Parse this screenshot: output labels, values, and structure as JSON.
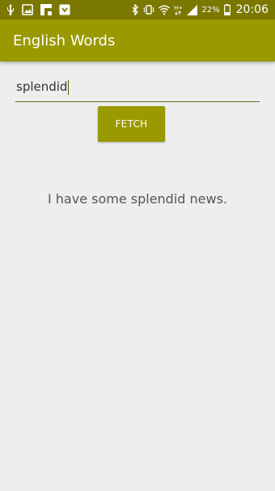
{
  "status_bar": {
    "icons": [
      "usb-icon",
      "image-icon",
      "flipboard-icon",
      "shield-icon",
      "bluetooth-icon",
      "vibrate-icon",
      "wifi-icon",
      "hplus-signal-icon",
      "signal-icon",
      "battery-icon"
    ],
    "battery_percent": "22%",
    "time": "20:06",
    "background": "#7a7800"
  },
  "app_bar": {
    "title": "English Words",
    "color": "#999900"
  },
  "search": {
    "value": "splendid"
  },
  "fetch_button": {
    "label": "FETCH",
    "color": "#999900"
  },
  "result": {
    "sentence": "I have some splendid news."
  }
}
